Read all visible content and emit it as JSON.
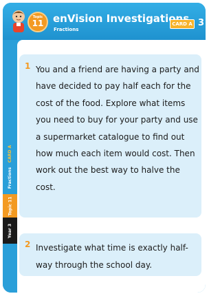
{
  "header": {
    "title": "enVision Investigations",
    "subtitle": "Fractions",
    "topic_word": "Topic",
    "topic_number": "11",
    "card_label": "CARD A",
    "card_number": "3"
  },
  "side": {
    "card_label": "CARD A",
    "section": "Fractions",
    "topic": "Topic 11",
    "year": "Year 3"
  },
  "tasks": [
    {
      "number": "1",
      "text": "You and a friend are having a party and have decided to pay half each for the cost of the food. Explore what items you need to buy for your party and use a supermarket catalogue to find out how much each item would cost. Then work out the best way to halve the cost."
    },
    {
      "number": "2",
      "text": "Investigate what time is exactly half-way through the school day."
    }
  ],
  "colors": {
    "brand_blue": "#2a9fd9",
    "accent_orange": "#f39a22",
    "task_bg": "#dbeffa"
  }
}
